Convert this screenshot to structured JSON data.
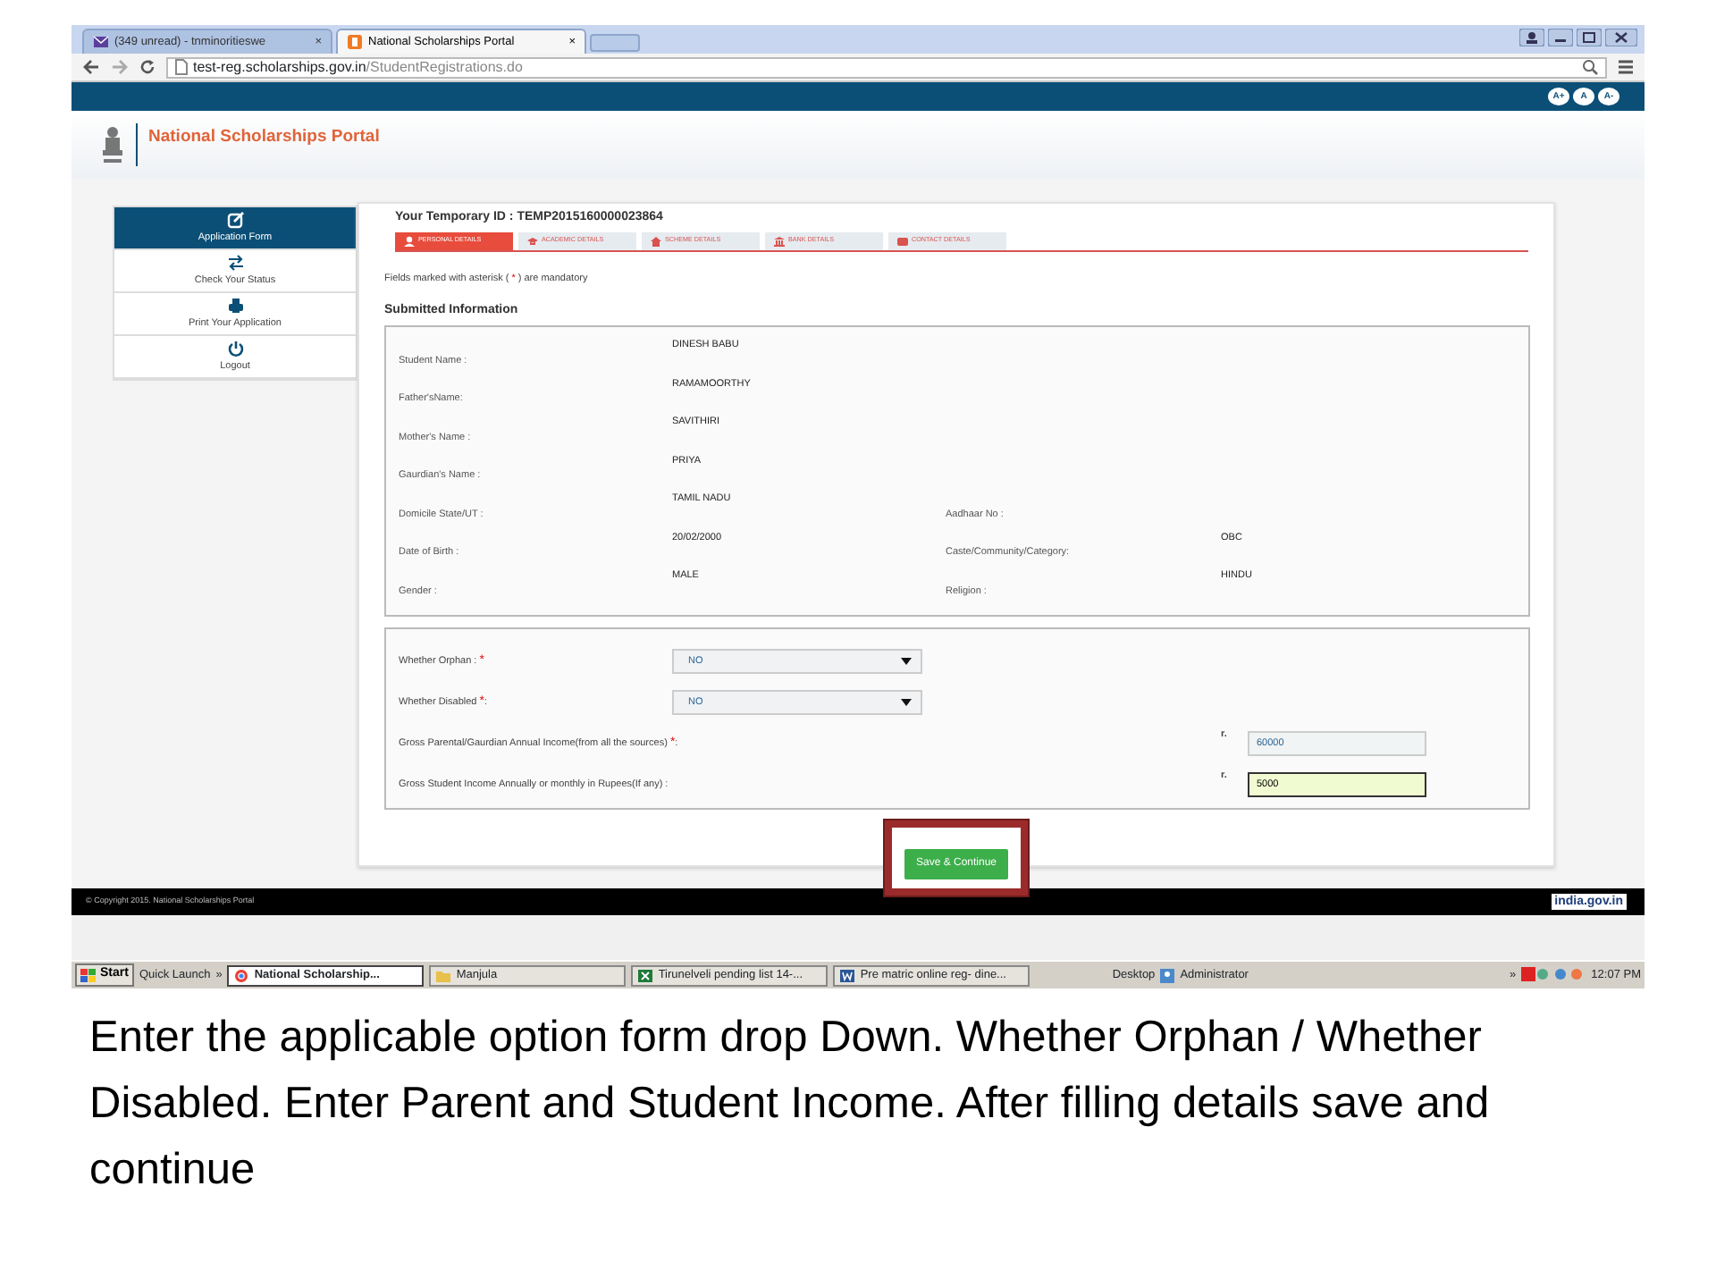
{
  "browser": {
    "tabs": [
      {
        "title": "(349 unread) - tnminoritieswe",
        "selected": false,
        "kind": "mail"
      },
      {
        "title": "National Scholarships Portal",
        "selected": true,
        "kind": "portal"
      }
    ],
    "close_glyph": "×",
    "url_host": "test-reg.scholarships.gov.in",
    "url_path": "/StudentRegistrations.do"
  },
  "font_buttons": [
    "A+",
    "A",
    "A-"
  ],
  "portal_title": "National Scholarships Portal",
  "sidebar": {
    "items": [
      {
        "label": "Application Form",
        "selected": true,
        "kind": "edit"
      },
      {
        "label": "Check Your Status",
        "selected": false,
        "kind": "swap"
      },
      {
        "label": "Print Your Application",
        "selected": false,
        "kind": "print"
      },
      {
        "label": "Logout",
        "selected": false,
        "kind": "power"
      }
    ]
  },
  "temp_id": "Your Temporary ID : TEMP2015160000023864",
  "form_tabs": [
    {
      "label": "PERSONAL DETAILS",
      "selected": true,
      "kind": "person"
    },
    {
      "label": "ACADEMIC DETAILS",
      "selected": false,
      "kind": "cap"
    },
    {
      "label": "SCHEME DETAILS",
      "selected": false,
      "kind": "home"
    },
    {
      "label": "BANK DETAILS",
      "selected": false,
      "kind": "bank"
    },
    {
      "label": "CONTACT DETAILS",
      "selected": false,
      "kind": "mail"
    }
  ],
  "mandatory_note": {
    "before": "Fields marked with asterisk (",
    "mark": "*",
    "after": ") are mandatory"
  },
  "section_title": "Submitted Information",
  "info_rows": [
    {
      "label": "Student Name :",
      "value": "DINESH  BABU"
    },
    {
      "label": "Father'sName:",
      "value": "RAMAMOORTHY"
    },
    {
      "label": "Mother's Name :",
      "value": "SAVITHIRI"
    },
    {
      "label": "Gaurdian's Name :",
      "value": "PRIYA"
    },
    {
      "label": "Domicile State/UT :",
      "value": "TAMIL NADU",
      "right_label": "Aadhaar No :"
    },
    {
      "label": "Date of Birth :",
      "value": "20/02/2000",
      "right_label": "Caste/Community/Category:",
      "right_value": "OBC"
    },
    {
      "label": "Gender :",
      "value": "MALE",
      "right_label": "Religion :",
      "right_value": "HINDU"
    }
  ],
  "questions": [
    {
      "kind": "select",
      "label": "Whether Orphan :",
      "required_mark": "*",
      "value": "NO"
    },
    {
      "kind": "select",
      "label": "Whether Disabled",
      "required_mark": "*",
      "suffix": ":",
      "value": "NO"
    },
    {
      "kind": "text",
      "label": "Gross Parental/Gaurdian Annual Income(from all the sources)",
      "required_mark": "*",
      "suffix": ":",
      "prefix": "r.",
      "value": "60000",
      "focused": false
    },
    {
      "kind": "text",
      "label": "Gross Student Income Annually or monthly in Rupees(If any) :",
      "prefix": "r.",
      "value": "5000",
      "focused": true
    }
  ],
  "save_button": {
    "label": "Save & Continue",
    "highlighted": true
  },
  "footer": {
    "copyright": "© Copyright 2015. National Scholarships Portal",
    "logo_text": "india.gov.in"
  },
  "taskbar": {
    "start": "Start",
    "quick_launch": "Quick Launch",
    "chevron": "»",
    "tasks": [
      {
        "label": "National Scholarship...",
        "selected": true,
        "kind": "browser"
      },
      {
        "label": "Manjula",
        "selected": false,
        "kind": "folder"
      },
      {
        "label": "Tirunelveli pending list 14-...",
        "selected": false,
        "kind": "sheet"
      },
      {
        "label": "Pre matric online reg- dine...",
        "selected": false,
        "kind": "doc"
      }
    ],
    "desktop": "Desktop",
    "user": "Administrator",
    "tray_chevron": "»",
    "clock": "12:07 PM"
  },
  "caption": "Enter the applicable option form drop Down. Whether Orphan / Whether Disabled. Enter Parent and Student Income. After filling details save and continue"
}
